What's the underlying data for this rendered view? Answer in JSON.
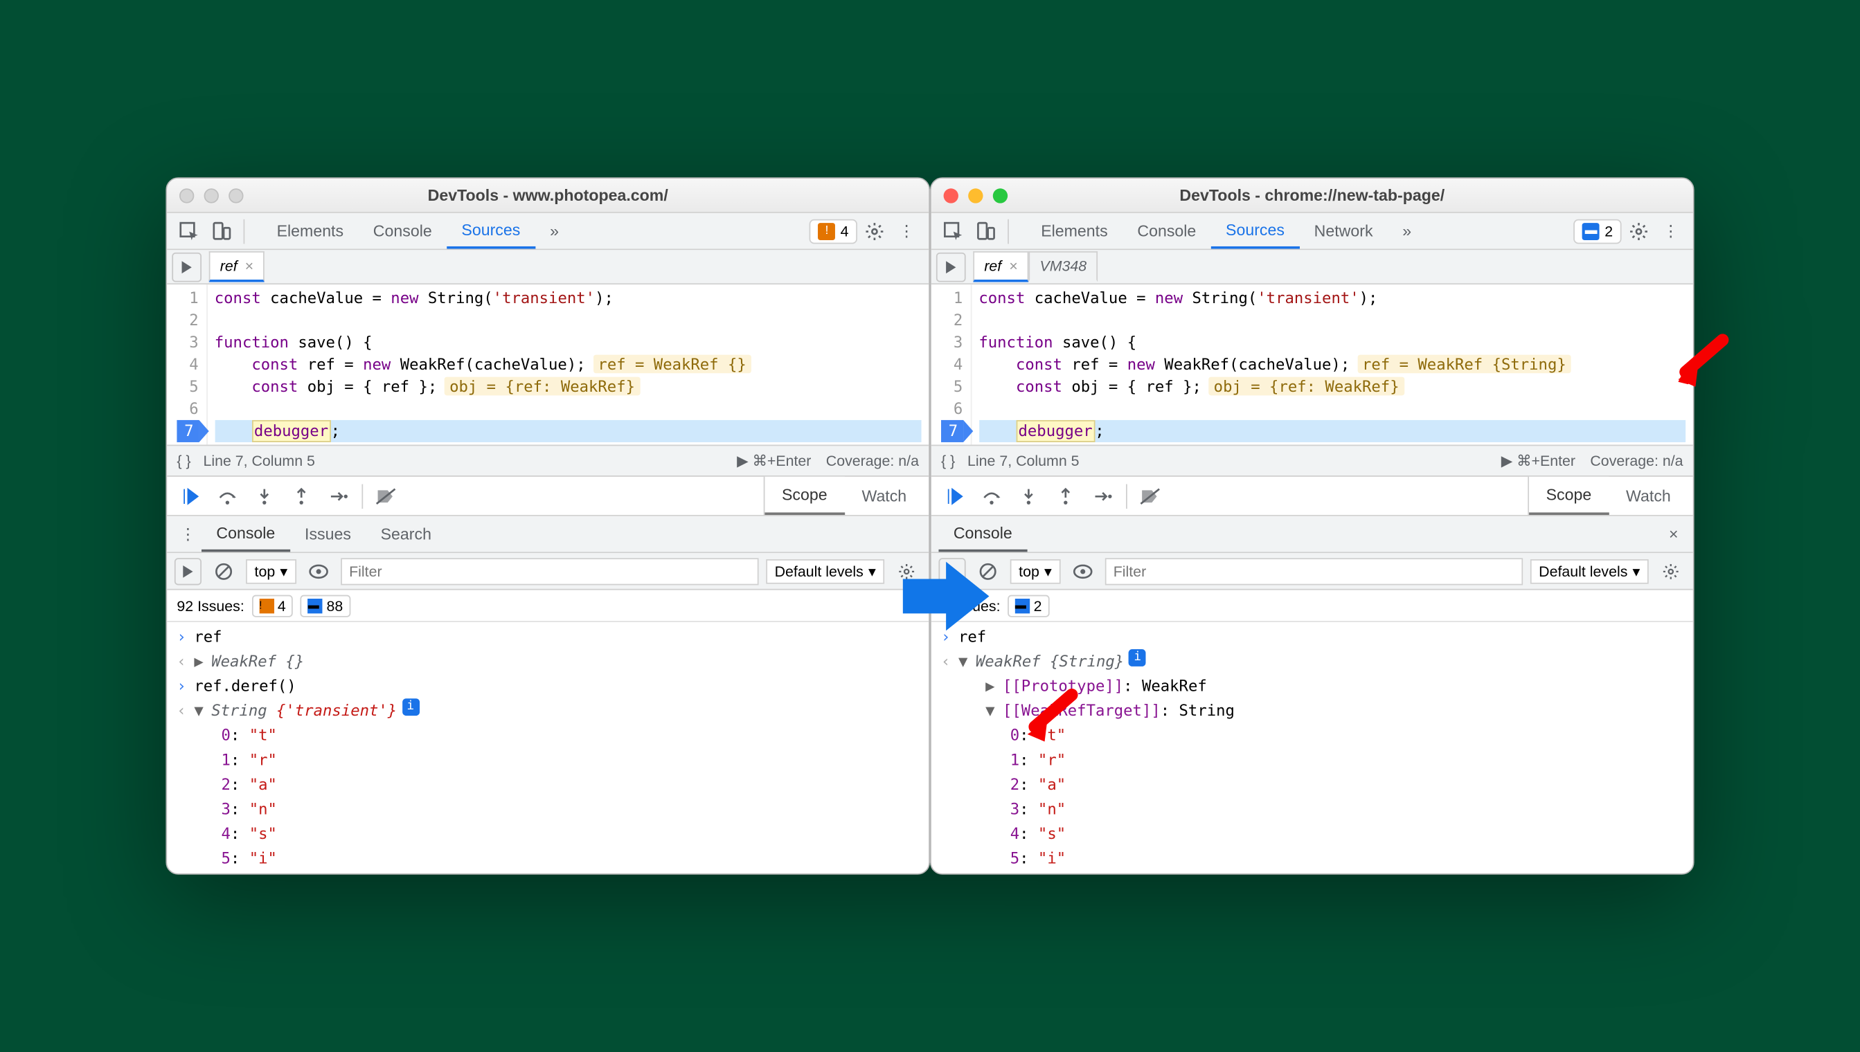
{
  "left": {
    "title": "DevTools - www.photopea.com/",
    "tabs": [
      "Elements",
      "Console",
      "Sources"
    ],
    "active_tab": "Sources",
    "issue_count": "4",
    "file_tab": "ref",
    "code": {
      "lines": [
        "1",
        "2",
        "3",
        "4",
        "5",
        "6",
        "7"
      ],
      "l1_a": "const",
      "l1_b": " cacheValue = ",
      "l1_c": "new",
      "l1_d": " String(",
      "l1_e": "'transient'",
      "l1_f": ");",
      "l3_a": "function",
      "l3_b": " save() {",
      "l4_a": "    const",
      "l4_b": " ref = ",
      "l4_c": "new",
      "l4_d": " WeakRef(cacheValue);",
      "l4_v": "ref = WeakRef {}",
      "l5_a": "    const",
      "l5_b": " obj = { ref };",
      "l5_v": "obj = {ref: WeakRef}",
      "l7_a": "    ",
      "l7_b": "debugger",
      "l7_c": ";"
    },
    "status_cursor": "Line 7, Column 5",
    "status_run": "⌘+Enter",
    "status_cov": "Coverage: n/a",
    "scope": "Scope",
    "watch": "Watch",
    "drawer_tabs": [
      "Console",
      "Issues",
      "Search"
    ],
    "filter_ctx": "top",
    "filter_placeholder": "Filter",
    "filter_levels": "Default levels",
    "issues_summary": "92 Issues:",
    "issues_warn": "4",
    "issues_info": "88",
    "console": {
      "in1": "ref",
      "out1": "WeakRef {}",
      "in2": "ref.deref()",
      "out2_label": "String ",
      "out2_val": "{'transient'}",
      "chars": [
        {
          "k": "0",
          "v": "\"t\""
        },
        {
          "k": "1",
          "v": "\"r\""
        },
        {
          "k": "2",
          "v": "\"a\""
        },
        {
          "k": "3",
          "v": "\"n\""
        },
        {
          "k": "4",
          "v": "\"s\""
        },
        {
          "k": "5",
          "v": "\"i\""
        }
      ]
    }
  },
  "right": {
    "title": "DevTools - chrome://new-tab-page/",
    "tabs": [
      "Elements",
      "Console",
      "Sources",
      "Network"
    ],
    "active_tab": "Sources",
    "issue_count": "2",
    "file_tab": "ref",
    "file_tab2": "VM348",
    "code": {
      "l4_v": "ref = WeakRef {String}",
      "l5_v": "obj = {ref: WeakRef}"
    },
    "status_cursor": "Line 7, Column 5",
    "status_run": "⌘+Enter",
    "status_cov": "Coverage: n/a",
    "scope": "Scope",
    "watch": "Watch",
    "drawer_tabs": [
      "Console"
    ],
    "filter_ctx": "top",
    "filter_placeholder": "Filter",
    "filter_levels": "Default levels",
    "issues_summary": "2 Issues:",
    "issues_info": "2",
    "console": {
      "in1": "ref",
      "out1": "WeakRef {String}",
      "proto_k": "[[Prototype]]",
      "proto_v": ": WeakRef",
      "target_k": "[[WeakRefTarget]]",
      "target_v": ": String",
      "chars": [
        {
          "k": "0",
          "v": "\"t\""
        },
        {
          "k": "1",
          "v": "\"r\""
        },
        {
          "k": "2",
          "v": "\"a\""
        },
        {
          "k": "3",
          "v": "\"n\""
        },
        {
          "k": "4",
          "v": "\"s\""
        },
        {
          "k": "5",
          "v": "\"i\""
        }
      ]
    }
  }
}
